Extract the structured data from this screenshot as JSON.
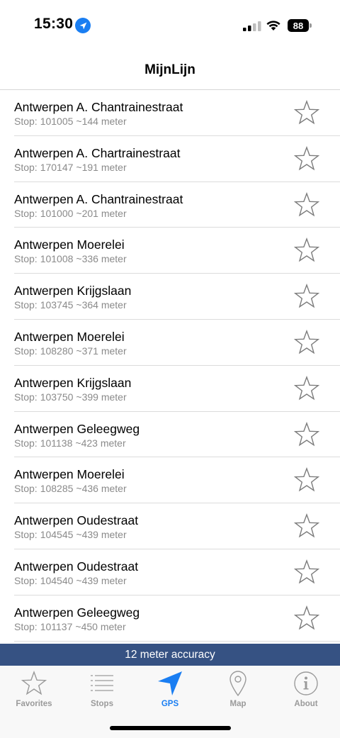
{
  "status_bar": {
    "time": "15:30",
    "battery": "88"
  },
  "nav": {
    "title": "MijnLijn"
  },
  "stops": [
    {
      "name": "Antwerpen A. Chantrainestraat",
      "stop_label": "Stop:",
      "stop_id": "101005",
      "distance": "~144 meter",
      "favorite": false
    },
    {
      "name": "Antwerpen A. Chartrainestraat",
      "stop_label": "Stop:",
      "stop_id": "170147",
      "distance": "~191 meter",
      "favorite": false
    },
    {
      "name": "Antwerpen A. Chantrainestraat",
      "stop_label": "Stop:",
      "stop_id": "101000",
      "distance": "~201 meter",
      "favorite": false
    },
    {
      "name": "Antwerpen Moerelei",
      "stop_label": "Stop:",
      "stop_id": "101008",
      "distance": "~336 meter",
      "favorite": false
    },
    {
      "name": "Antwerpen Krijgslaan",
      "stop_label": "Stop:",
      "stop_id": "103745",
      "distance": "~364 meter",
      "favorite": false
    },
    {
      "name": "Antwerpen Moerelei",
      "stop_label": "Stop:",
      "stop_id": "108280",
      "distance": "~371 meter",
      "favorite": false
    },
    {
      "name": "Antwerpen Krijgslaan",
      "stop_label": "Stop:",
      "stop_id": "103750",
      "distance": "~399 meter",
      "favorite": false
    },
    {
      "name": "Antwerpen Geleegweg",
      "stop_label": "Stop:",
      "stop_id": "101138",
      "distance": "~423 meter",
      "favorite": false
    },
    {
      "name": "Antwerpen Moerelei",
      "stop_label": "Stop:",
      "stop_id": "108285",
      "distance": "~436 meter",
      "favorite": false
    },
    {
      "name": "Antwerpen Oudestraat",
      "stop_label": "Stop:",
      "stop_id": "104545",
      "distance": "~439 meter",
      "favorite": false
    },
    {
      "name": "Antwerpen Oudestraat",
      "stop_label": "Stop:",
      "stop_id": "104540",
      "distance": "~439 meter",
      "favorite": false
    },
    {
      "name": "Antwerpen Geleegweg",
      "stop_label": "Stop:",
      "stop_id": "101137",
      "distance": "~450 meter",
      "favorite": false
    }
  ],
  "accuracy": {
    "text": "12 meter accuracy"
  },
  "tabs": [
    {
      "label": "Favorites",
      "icon": "star-icon",
      "active": false
    },
    {
      "label": "Stops",
      "icon": "list-icon",
      "active": false
    },
    {
      "label": "GPS",
      "icon": "location-arrow-icon",
      "active": true
    },
    {
      "label": "Map",
      "icon": "map-pin-icon",
      "active": false
    },
    {
      "label": "About",
      "icon": "info-icon",
      "active": false
    }
  ],
  "colors": {
    "accent": "#1a7ef2",
    "accuracy_bar": "#365283",
    "inactive": "#9a9a9a"
  }
}
